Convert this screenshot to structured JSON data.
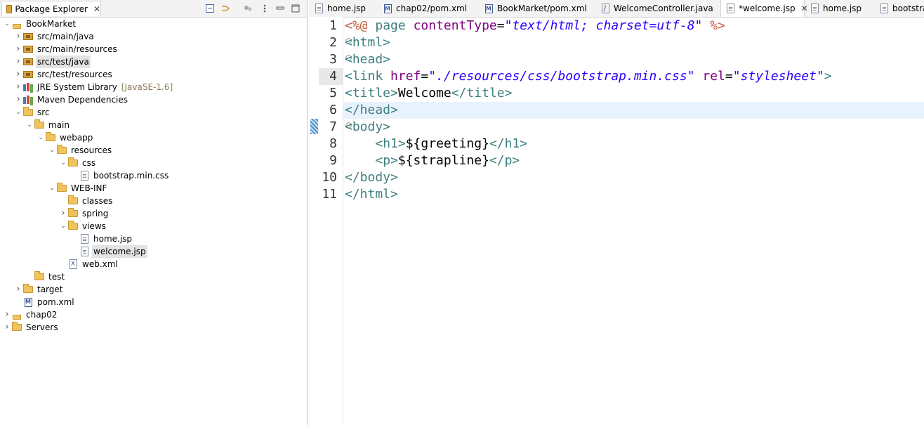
{
  "explorer": {
    "title": "Package Explorer",
    "close": "✕",
    "tree": [
      {
        "label": "BookMarket",
        "icon": "maven-project-icon",
        "depth": 0,
        "twisty": "open"
      },
      {
        "label": "src/main/java",
        "icon": "package-folder-icon",
        "depth": 1,
        "twisty": "closed"
      },
      {
        "label": "src/main/resources",
        "icon": "package-folder-icon",
        "depth": 1,
        "twisty": "closed"
      },
      {
        "label": "src/test/java",
        "icon": "package-folder-icon",
        "depth": 1,
        "twisty": "closed",
        "selected": true
      },
      {
        "label": "src/test/resources",
        "icon": "package-folder-icon",
        "depth": 1,
        "twisty": "closed"
      },
      {
        "label": "JRE System Library",
        "decoration": "[JavaSE-1.6]",
        "icon": "library-icon",
        "depth": 1,
        "twisty": "closed"
      },
      {
        "label": "Maven Dependencies",
        "icon": "library-icon",
        "depth": 1,
        "twisty": "closed"
      },
      {
        "label": "src",
        "icon": "folder-icon",
        "depth": 1,
        "twisty": "open"
      },
      {
        "label": "main",
        "icon": "folder-icon",
        "depth": 2,
        "twisty": "open"
      },
      {
        "label": "webapp",
        "icon": "folder-icon",
        "depth": 3,
        "twisty": "open"
      },
      {
        "label": "resources",
        "icon": "folder-icon",
        "depth": 4,
        "twisty": "open"
      },
      {
        "label": "css",
        "icon": "folder-icon",
        "depth": 5,
        "twisty": "open"
      },
      {
        "label": "bootstrap.min.css",
        "icon": "file-icon",
        "depth": 6,
        "twisty": ""
      },
      {
        "label": "WEB-INF",
        "icon": "folder-icon",
        "depth": 4,
        "twisty": "open"
      },
      {
        "label": "classes",
        "icon": "folder-icon",
        "depth": 5,
        "twisty": ""
      },
      {
        "label": "spring",
        "icon": "folder-icon",
        "depth": 5,
        "twisty": "closed"
      },
      {
        "label": "views",
        "icon": "folder-icon",
        "depth": 5,
        "twisty": "open"
      },
      {
        "label": "home.jsp",
        "icon": "file-icon",
        "depth": 6,
        "twisty": ""
      },
      {
        "label": "welcome.jsp",
        "icon": "file-icon",
        "depth": 6,
        "twisty": "",
        "selected": true
      },
      {
        "label": "web.xml",
        "icon": "xml-file-icon",
        "depth": 5,
        "twisty": ""
      },
      {
        "label": "test",
        "icon": "folder-icon",
        "depth": 2,
        "twisty": ""
      },
      {
        "label": "target",
        "icon": "folder-icon",
        "depth": 1,
        "twisty": "closed"
      },
      {
        "label": "pom.xml",
        "icon": "maven-file-icon",
        "depth": 1,
        "twisty": ""
      },
      {
        "label": "chap02",
        "icon": "maven-project-icon",
        "depth": 0,
        "twisty": "closed"
      },
      {
        "label": "Servers",
        "icon": "folder-icon",
        "depth": 0,
        "twisty": "closed"
      }
    ]
  },
  "editor": {
    "tabs": [
      {
        "label": "home.jsp",
        "icon": "file-icon"
      },
      {
        "label": "chap02/pom.xml",
        "icon": "maven-file-icon"
      },
      {
        "label": "BookMarket/pom.xml",
        "icon": "maven-file-icon"
      },
      {
        "label": "WelcomeController.java",
        "icon": "java-file-icon"
      },
      {
        "label": "*welcome.jsp",
        "icon": "file-icon",
        "active": true,
        "close": "✕"
      },
      {
        "label": "home.jsp",
        "icon": "file-icon"
      },
      {
        "label": "bootstrap",
        "icon": "file-icon"
      }
    ],
    "current_line": 4,
    "highlighted_line": 6,
    "lines": [
      {
        "n": "1",
        "tokens": [
          [
            "dir",
            "<%@"
          ],
          [
            "txt",
            " "
          ],
          [
            "tag",
            "page"
          ],
          [
            "txt",
            " "
          ],
          [
            "attr",
            "contentType"
          ],
          [
            "txt",
            "="
          ],
          [
            "str",
            "\"text/html; charset=utf-8\""
          ],
          [
            "txt",
            " "
          ],
          [
            "dir",
            "%>"
          ]
        ]
      },
      {
        "n": "2",
        "fold": true,
        "tokens": [
          [
            "tag",
            "<html>"
          ]
        ]
      },
      {
        "n": "3",
        "fold": true,
        "tokens": [
          [
            "tag",
            "<head>"
          ]
        ]
      },
      {
        "n": "4",
        "tokens": [
          [
            "tag",
            "<link"
          ],
          [
            "txt",
            " "
          ],
          [
            "attr",
            "href"
          ],
          [
            "txt",
            "="
          ],
          [
            "str",
            "\"./resources/css/bootstrap.min.css\""
          ],
          [
            "txt",
            " "
          ],
          [
            "attr",
            "rel"
          ],
          [
            "txt",
            "="
          ],
          [
            "str",
            "\"stylesheet\""
          ],
          [
            "tag",
            ">"
          ]
        ]
      },
      {
        "n": "5",
        "tokens": [
          [
            "tag",
            "<title>"
          ],
          [
            "txt",
            "Welcome"
          ],
          [
            "tag",
            "</title>"
          ]
        ]
      },
      {
        "n": "6",
        "tokens": [
          [
            "tag",
            "</head>"
          ]
        ]
      },
      {
        "n": "7",
        "fold": true,
        "tokens": [
          [
            "tag",
            "<body>"
          ]
        ]
      },
      {
        "n": "8",
        "tokens": [
          [
            "txt",
            "    "
          ],
          [
            "tag",
            "<h1>"
          ],
          [
            "txt",
            "${greeting}"
          ],
          [
            "tag",
            "</h1>"
          ]
        ]
      },
      {
        "n": "9",
        "tokens": [
          [
            "txt",
            "    "
          ],
          [
            "tag",
            "<p>"
          ],
          [
            "txt",
            "${strapline}"
          ],
          [
            "tag",
            "</p>"
          ]
        ]
      },
      {
        "n": "10",
        "tokens": [
          [
            "tag",
            "</body>"
          ]
        ]
      },
      {
        "n": "11",
        "tokens": [
          [
            "tag",
            "</html>"
          ]
        ]
      }
    ]
  }
}
